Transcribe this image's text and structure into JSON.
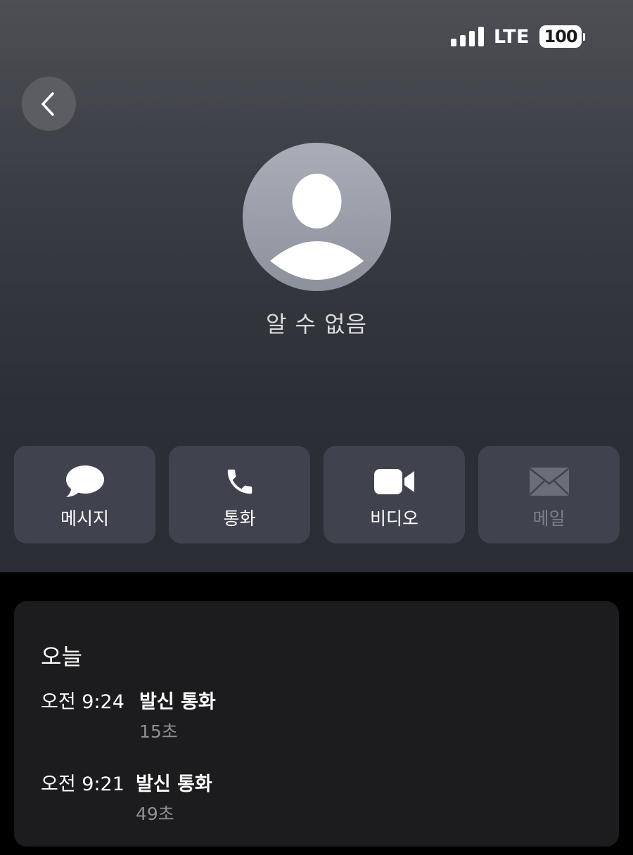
{
  "status_bar": {
    "network": "LTE",
    "battery_level": "100",
    "signal_bars": 4
  },
  "contact": {
    "name": "알 수 없음"
  },
  "actions": [
    {
      "label": "메시지",
      "icon": "message-bubble-icon",
      "enabled": true
    },
    {
      "label": "통화",
      "icon": "phone-icon",
      "enabled": true
    },
    {
      "label": "비디오",
      "icon": "video-camera-icon",
      "enabled": true
    },
    {
      "label": "메일",
      "icon": "envelope-icon",
      "enabled": false
    }
  ],
  "recents": {
    "section_title": "오늘",
    "calls": [
      {
        "time": "오전 9:24",
        "type": "발신 통화",
        "duration": "15초"
      },
      {
        "time": "오전 9:21",
        "type": "발신 통화",
        "duration": "49초"
      }
    ]
  },
  "colors": {
    "header_bg_top": "#4d4f55",
    "header_bg_bottom": "#2b2d35",
    "button_bg": "#40434e",
    "card_bg": "#1c1c1e",
    "disabled_text": "#7d7f88",
    "secondary_text": "#8e8e93"
  }
}
